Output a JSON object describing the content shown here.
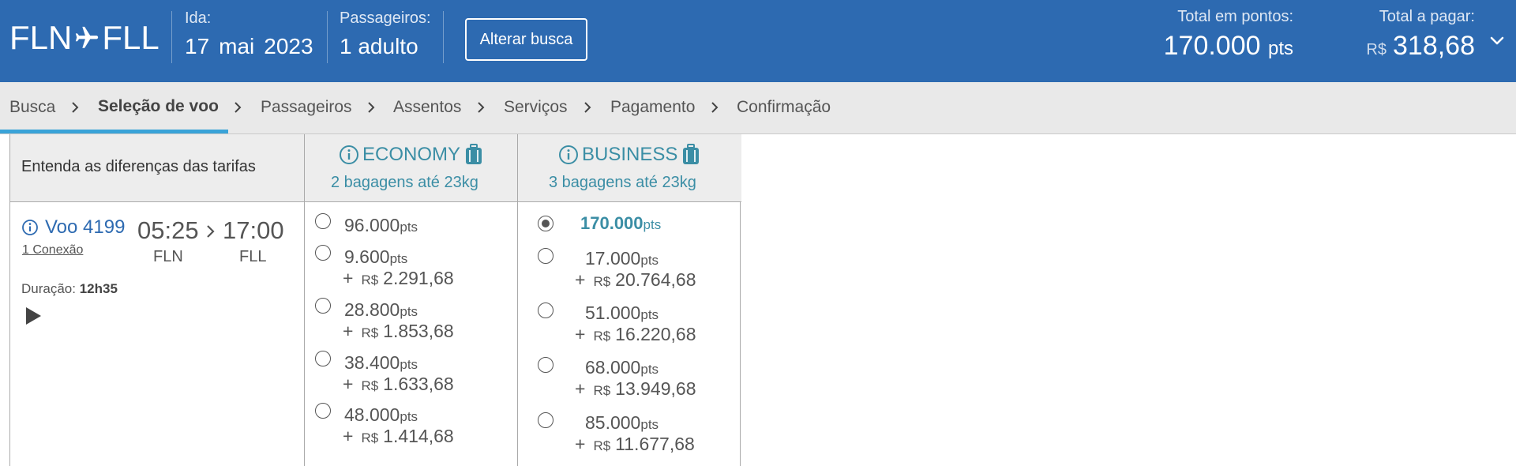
{
  "header": {
    "origin": "FLN",
    "destination": "FLL",
    "date_label": "Ida:",
    "date_day": "17",
    "date_month": "mai",
    "date_year": "2023",
    "passengers_label": "Passageiros:",
    "passengers_value": "1 adulto",
    "change_search_button": "Alterar busca",
    "total_points_label": "Total em pontos:",
    "total_points_value": "170.000",
    "total_points_unit": "pts",
    "total_pay_label": "Total a pagar:",
    "total_pay_currency": "R$",
    "total_pay_value": "318,68"
  },
  "breadcrumb": {
    "steps": [
      "Busca",
      "Seleção de voo",
      "Passageiros",
      "Assentos",
      "Serviços",
      "Pagamento",
      "Confirmação"
    ],
    "active": "Seleção de voo"
  },
  "table": {
    "header_left": "Entenda as diferenças das tarifas",
    "economy_title": "ECONOMY",
    "economy_sub": "2 bagagens até 23kg",
    "business_title": "BUSINESS",
    "business_sub": "3 bagagens até 23kg"
  },
  "flight": {
    "number": "Voo 4199",
    "connection": "1 Conexão",
    "departure_time": "05:25",
    "arrival_time": "17:00",
    "departure_airport": "FLN",
    "arrival_airport": "FLL",
    "duration_label": "Duração:",
    "duration_value": "12h35"
  },
  "fares": {
    "unit_pts": "pts",
    "currency": "R$",
    "plus": "+",
    "economy": [
      {
        "points": "96.000",
        "money": ""
      },
      {
        "points": "9.600",
        "money": "2.291,68"
      },
      {
        "points": "28.800",
        "money": "1.853,68"
      },
      {
        "points": "38.400",
        "money": "1.633,68"
      },
      {
        "points": "48.000",
        "money": "1.414,68"
      }
    ],
    "business": [
      {
        "points": "170.000",
        "money": "",
        "selected": true
      },
      {
        "points": "17.000",
        "money": "20.764,68"
      },
      {
        "points": "51.000",
        "money": "16.220,68"
      },
      {
        "points": "68.000",
        "money": "13.949,68"
      },
      {
        "points": "85.000",
        "money": "11.677,68"
      }
    ]
  },
  "colors": {
    "header_bg": "#2d6ab1",
    "accent_teal": "#3b8ea5",
    "active_step_bar": "#3aa3d8"
  }
}
